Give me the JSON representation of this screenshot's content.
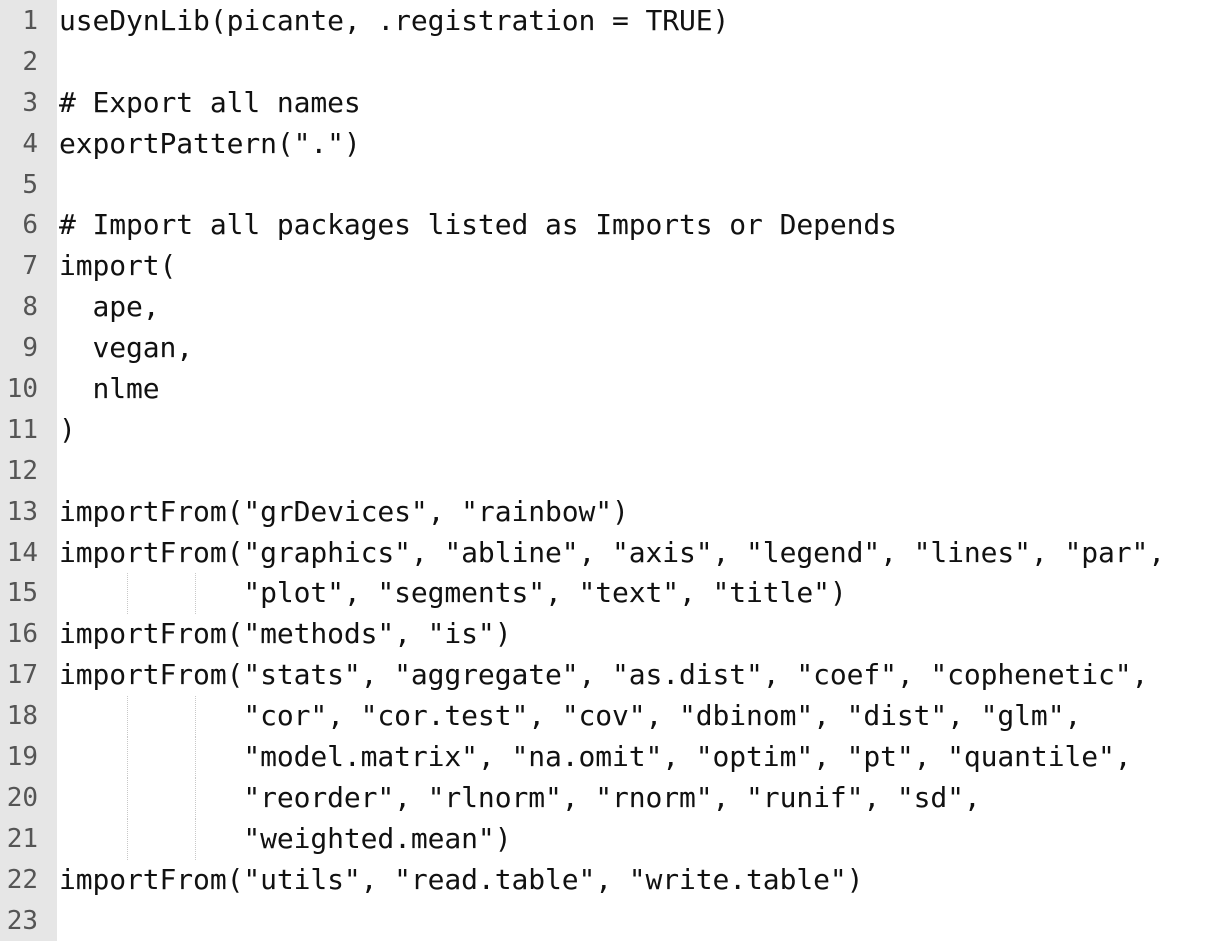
{
  "editor": {
    "lines": [
      {
        "num": "1",
        "text": "useDynLib(picante, .registration = TRUE)"
      },
      {
        "num": "2",
        "text": ""
      },
      {
        "num": "3",
        "text": "# Export all names"
      },
      {
        "num": "4",
        "text": "exportPattern(\".\")"
      },
      {
        "num": "5",
        "text": ""
      },
      {
        "num": "6",
        "text": "# Import all packages listed as Imports or Depends"
      },
      {
        "num": "7",
        "text": "import("
      },
      {
        "num": "8",
        "text": "  ape,"
      },
      {
        "num": "9",
        "text": "  vegan,"
      },
      {
        "num": "10",
        "text": "  nlme"
      },
      {
        "num": "11",
        "text": ")"
      },
      {
        "num": "12",
        "text": ""
      },
      {
        "num": "13",
        "text": "importFrom(\"grDevices\", \"rainbow\")"
      },
      {
        "num": "14",
        "text": "importFrom(\"graphics\", \"abline\", \"axis\", \"legend\", \"lines\", \"par\","
      },
      {
        "num": "15",
        "text": "           \"plot\", \"segments\", \"text\", \"title\")"
      },
      {
        "num": "16",
        "text": "importFrom(\"methods\", \"is\")"
      },
      {
        "num": "17",
        "text": "importFrom(\"stats\", \"aggregate\", \"as.dist\", \"coef\", \"cophenetic\","
      },
      {
        "num": "18",
        "text": "           \"cor\", \"cor.test\", \"cov\", \"dbinom\", \"dist\", \"glm\","
      },
      {
        "num": "19",
        "text": "           \"model.matrix\", \"na.omit\", \"optim\", \"pt\", \"quantile\","
      },
      {
        "num": "20",
        "text": "           \"reorder\", \"rlnorm\", \"rnorm\", \"runif\", \"sd\","
      },
      {
        "num": "21",
        "text": "           \"weighted.mean\")"
      },
      {
        "num": "22",
        "text": "importFrom(\"utils\", \"read.table\", \"write.table\")"
      },
      {
        "num": "23",
        "text": ""
      }
    ]
  }
}
